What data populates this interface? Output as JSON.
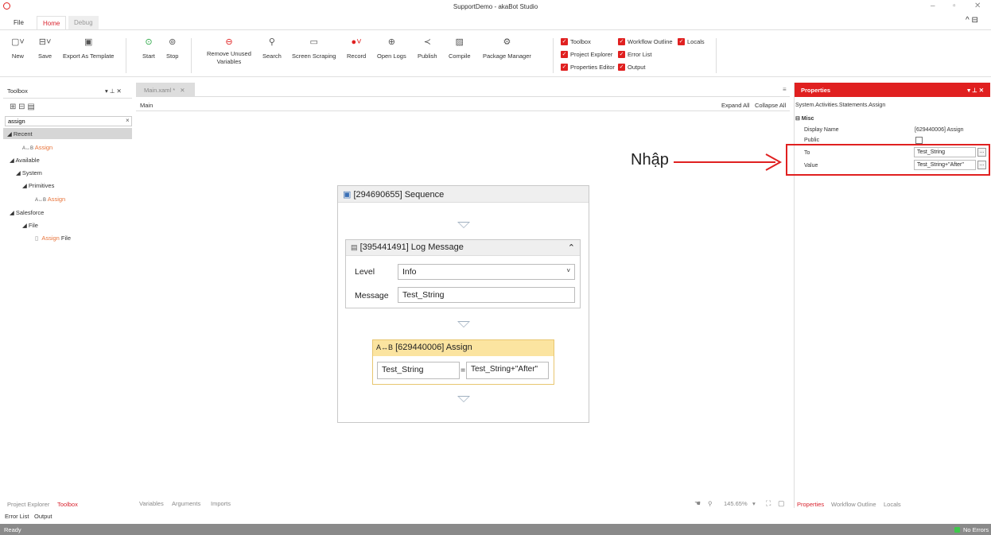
{
  "window": {
    "title": "SupportDemo - akaBot Studio"
  },
  "ribbon_tabs": [
    {
      "label": "File"
    },
    {
      "label": "Home"
    },
    {
      "label": "Debug"
    }
  ],
  "ribbon_buttons": [
    {
      "label": "New",
      "icon": "new-file-icon"
    },
    {
      "label": "Save",
      "icon": "save-icon"
    },
    {
      "label": "Export As Template",
      "icon": "export-template-icon"
    },
    {
      "label": "Start",
      "icon": "play-icon"
    },
    {
      "label": "Stop",
      "icon": "stop-icon"
    },
    {
      "label": "Remove Unused\nVariables",
      "icon": "remove-icon"
    },
    {
      "label": "Search",
      "icon": "search-icon"
    },
    {
      "label": "Screen Scraping",
      "icon": "screen-scraping-icon"
    },
    {
      "label": "Record",
      "icon": "record-icon"
    },
    {
      "label": "Open Logs",
      "icon": "logs-icon"
    },
    {
      "label": "Publish",
      "icon": "publish-icon"
    },
    {
      "label": "Compile",
      "icon": "compile-icon"
    },
    {
      "label": "Package Manager",
      "icon": "package-icon"
    }
  ],
  "view_checks": [
    {
      "label": "Toolbox"
    },
    {
      "label": "Project Explorer"
    },
    {
      "label": "Properties Editor"
    },
    {
      "label": "Workflow Outline"
    },
    {
      "label": "Error List"
    },
    {
      "label": "Output"
    },
    {
      "label": "Locals"
    }
  ],
  "toolbox": {
    "title": "Toolbox",
    "search_value": "assign",
    "tree": [
      {
        "label": "◢ Recent"
      },
      {
        "label": "Assign"
      },
      {
        "label": "◢ Available"
      },
      {
        "label": "◢ System"
      },
      {
        "label": "◢ Primitives"
      },
      {
        "label": "Assign"
      },
      {
        "label": "◢ Salesforce"
      },
      {
        "label": "◢ File"
      },
      {
        "label": "Assign",
        "suffix": " File"
      }
    ]
  },
  "document": {
    "tab": "Main.xaml *",
    "breadcrumb": "Main",
    "expand_all": "Expand All",
    "collapse_all": "Collapse All"
  },
  "sequence": {
    "title": "[294690655] Sequence"
  },
  "log_message": {
    "title": "[395441491] Log Message",
    "level_label": "Level",
    "level_value": "Info",
    "message_label": "Message",
    "message_value": "Test_String"
  },
  "assign": {
    "title": "[629440006] Assign",
    "to": "Test_String",
    "eq": "=",
    "value": "Test_String+\"After\""
  },
  "properties": {
    "title": "Properties",
    "type": "System.Activities.Statements.Assign",
    "section": "⊟ Misc",
    "rows": [
      {
        "name": "Display Name",
        "value": "[629440006] Assign"
      },
      {
        "name": "Public",
        "value": ""
      },
      {
        "name": "To",
        "value": "Test_String"
      },
      {
        "name": "Value",
        "value": "Test_String+\"After\""
      }
    ]
  },
  "annotation": "Nhập",
  "bottom": {
    "left_tabs": [
      "Project Explorer",
      "Toolbox"
    ],
    "center_tabs": [
      "Variables",
      "Arguments",
      "Imports"
    ],
    "zoom": "145.65%",
    "right_tabs": [
      "Properties",
      "Workflow Outline",
      "Locals"
    ],
    "output_tabs": [
      "Error List",
      "Output"
    ]
  },
  "status": {
    "left": "Ready",
    "right": "No Errors"
  }
}
